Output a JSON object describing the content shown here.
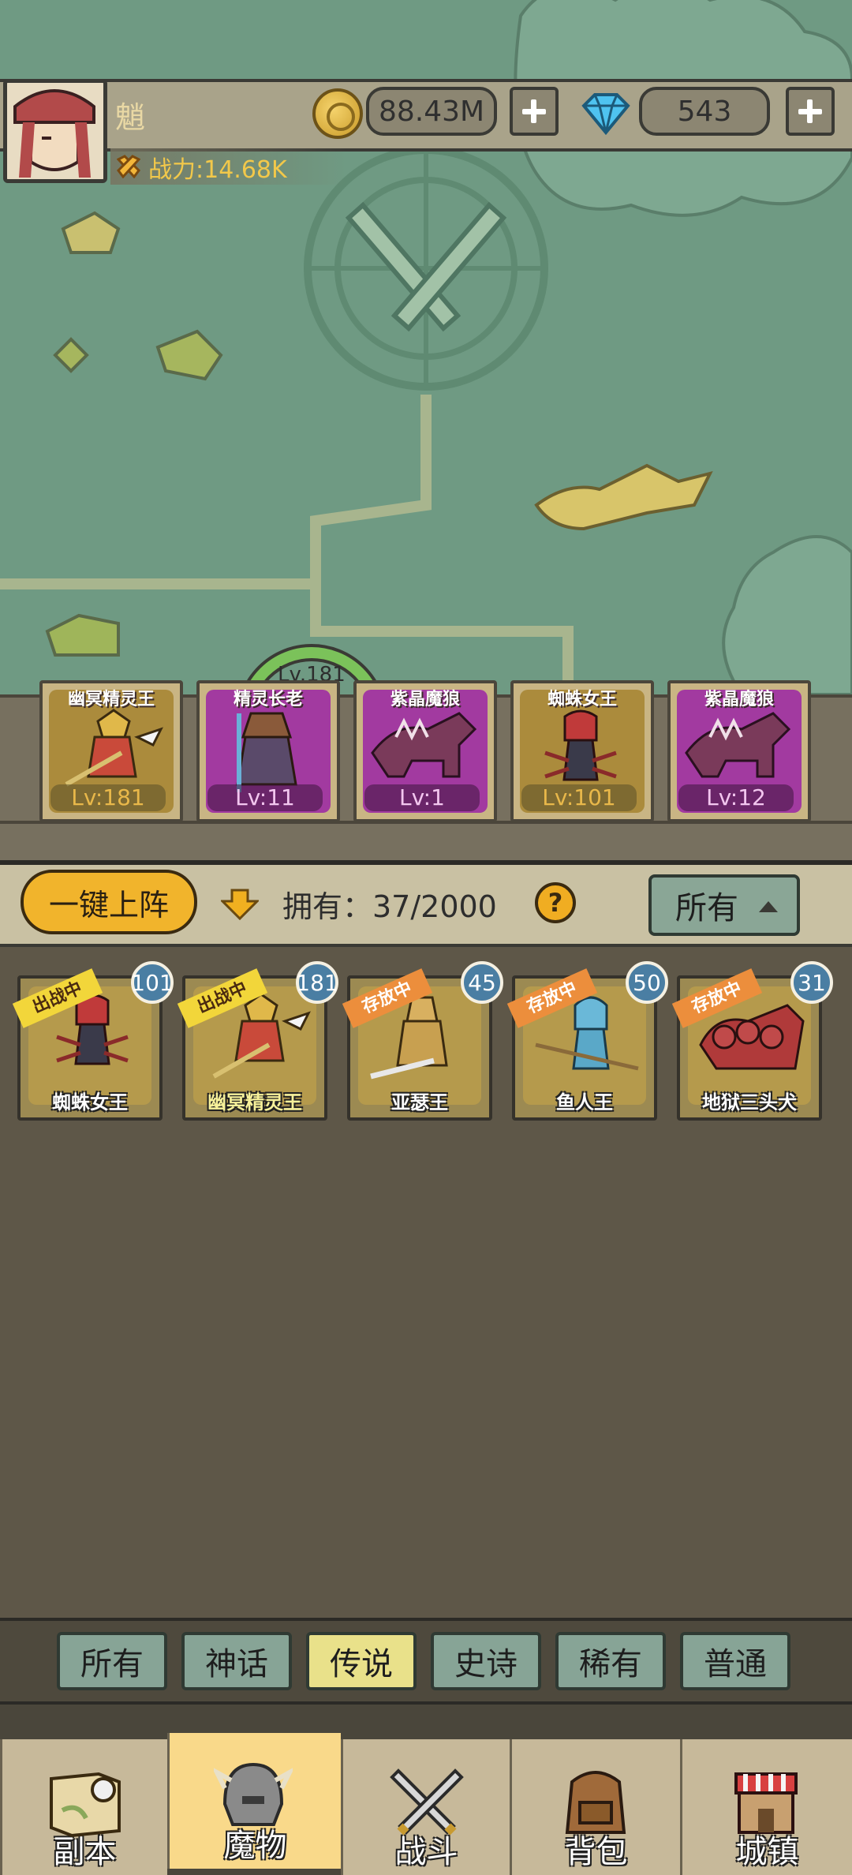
{
  "player": {
    "name": "魈",
    "gold": "88.43M",
    "gems": "543",
    "power": "战力:14.68K"
  },
  "team_level_ring": "Lv.181",
  "team": [
    {
      "name": "幽冥精灵王",
      "level": "Lv:181",
      "frame": "gold"
    },
    {
      "name": "精灵长老",
      "level": "Lv:11",
      "frame": "purple"
    },
    {
      "name": "紫晶魔狼",
      "level": "Lv:1",
      "frame": "purple"
    },
    {
      "name": "蜘蛛女王",
      "level": "Lv:101",
      "frame": "gold"
    },
    {
      "name": "紫晶魔狼",
      "level": "Lv:12",
      "frame": "purple"
    }
  ],
  "toolbar": {
    "deploy_label": "一键上阵",
    "owned_label": "拥有：37/2000",
    "help": "?",
    "filter_label": "所有"
  },
  "monsters": [
    {
      "name": "蜘蛛女王",
      "status": "出战中",
      "level": "101"
    },
    {
      "name": "幽冥精灵王",
      "status": "出战中",
      "level": "181"
    },
    {
      "name": "亚瑟王",
      "status": "存放中",
      "level": "45"
    },
    {
      "name": "鱼人王",
      "status": "存放中",
      "level": "50"
    },
    {
      "name": "地狱三头犬",
      "status": "存放中",
      "level": "31"
    }
  ],
  "rarity_tabs": [
    {
      "label": "所有"
    },
    {
      "label": "神话"
    },
    {
      "label": "传说",
      "active": true
    },
    {
      "label": "史诗"
    },
    {
      "label": "稀有"
    },
    {
      "label": "普通"
    }
  ],
  "nav": [
    {
      "label": "副本",
      "icon": "map-scroll-icon"
    },
    {
      "label": "魔物",
      "icon": "helmet-icon",
      "active": true
    },
    {
      "label": "战斗",
      "icon": "crossed-swords-icon"
    },
    {
      "label": "背包",
      "icon": "backpack-icon"
    },
    {
      "label": "城镇",
      "icon": "shop-house-icon"
    }
  ],
  "colors": {
    "map_bg": "#6f9a83",
    "gold_accent": "#f1b42c",
    "badge_blue": "#4a7ea3",
    "active_tab": "#e9e18a"
  }
}
